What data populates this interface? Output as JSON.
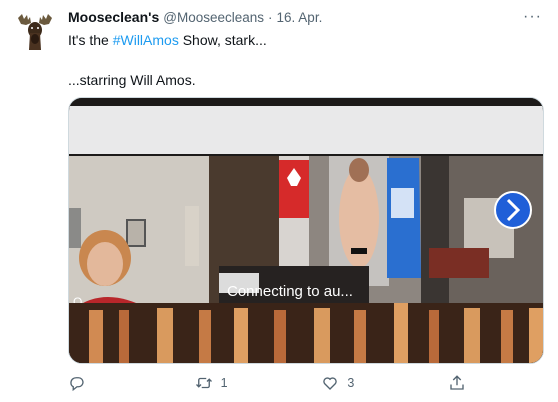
{
  "tweet": {
    "display_name": "Mooseclean's",
    "handle": "@Mooseecleans",
    "separator": "·",
    "date": "16. Apr.",
    "text_before_hashtag": "It's the ",
    "hashtag": "#WillAmos",
    "text_after_hashtag": " Show, stark...",
    "second_line": "...starring Will Amos.",
    "media": {
      "overlay_text": "Connecting to au...",
      "next_button_icon": "chevron-right-icon"
    },
    "actions": {
      "reply_count": "",
      "retweet_count": "1",
      "like_count": "3",
      "share_count": ""
    },
    "colors": {
      "accent": "#1d9bf0",
      "secondary_text": "#536471"
    }
  }
}
